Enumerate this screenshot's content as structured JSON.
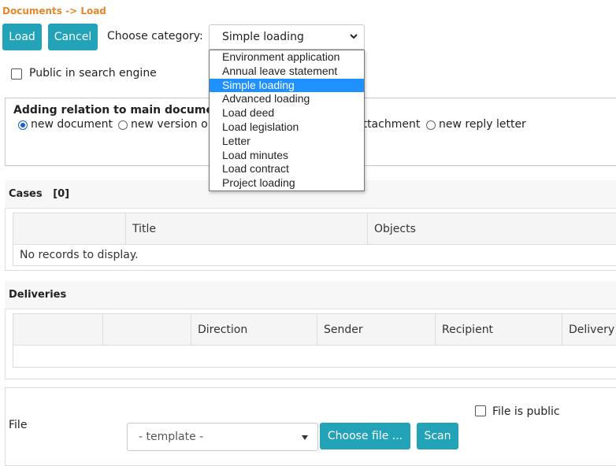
{
  "breadcrumb": "Documents -> Load",
  "toolbar": {
    "load_label": "Load",
    "cancel_label": "Cancel",
    "category_label": "Choose category:",
    "category_value": "Simple loading"
  },
  "category_options": [
    "Environment application",
    "Annual leave statement",
    "Simple loading",
    "Advanced loading",
    "Load deed",
    "Load legislation",
    "Letter",
    "Load minutes",
    "Load contract",
    "Project loading"
  ],
  "public_search_label": "Public in search engine",
  "relation": {
    "title": "Adding relation to main docume",
    "options": [
      "new document",
      "new version o",
      "attachment",
      "new reply letter"
    ]
  },
  "cases": {
    "title": "Cases",
    "count": "[0]",
    "columns": [
      "Title",
      "Objects"
    ],
    "empty_text": "No records to display."
  },
  "deliveries": {
    "title": "Deliveries",
    "columns": [
      "Direction",
      "Sender",
      "Recipient",
      "Delivery"
    ]
  },
  "file": {
    "label": "File",
    "template_placeholder": "- template -",
    "choose_label": "Choose file ...",
    "scan_label": "Scan",
    "public_label": "File is public"
  },
  "colors": {
    "accent": "#22a3b8",
    "breadcrumb": "#e8862a",
    "selection": "#1e90ff"
  }
}
